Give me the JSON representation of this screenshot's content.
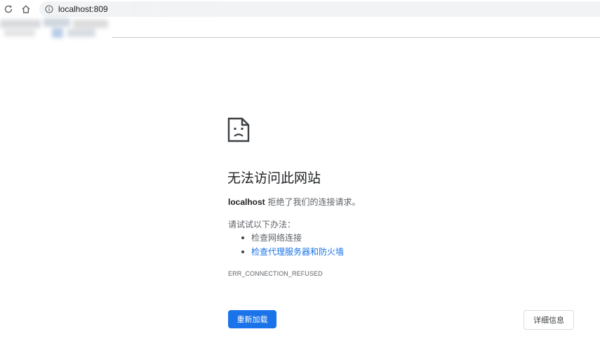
{
  "browser": {
    "url": "localhost:809"
  },
  "error_page": {
    "title": "无法访问此网站",
    "host": "localhost",
    "summary_suffix": " 拒绝了我们的连接请求。",
    "suggestions_heading": "请试试以下办法：",
    "suggestions": [
      {
        "label": "检查网络连接",
        "is_link": false
      },
      {
        "label": "检查代理服务器和防火墙",
        "is_link": true
      }
    ],
    "error_code": "ERR_CONNECTION_REFUSED",
    "reload_label": "重新加载",
    "details_label": "详细信息"
  },
  "colors": {
    "accent": "#1a73e8",
    "text_primary": "#202124",
    "text_secondary": "#5f6368"
  },
  "icons": {
    "reload": "reload-icon",
    "home": "home-icon",
    "info": "info-icon",
    "page": "sad-page-icon"
  }
}
